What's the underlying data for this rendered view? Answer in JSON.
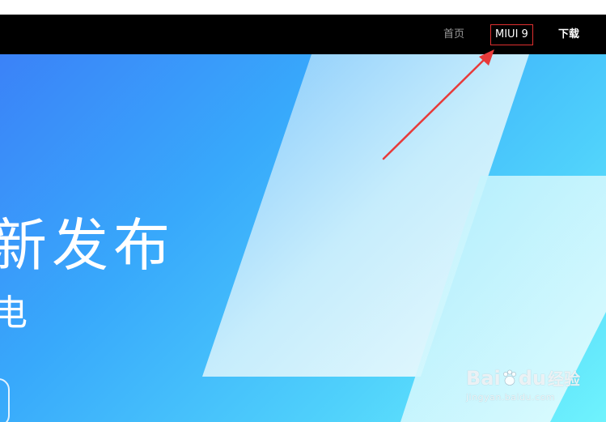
{
  "nav": {
    "items": [
      {
        "label": "首页"
      },
      {
        "label": "MIUI 9"
      },
      {
        "label": "下载"
      }
    ]
  },
  "hero": {
    "title": "新发布",
    "subtitle": "电"
  },
  "watermark": {
    "logo": "Bai",
    "logo_suffix": "du",
    "logo_cn": "经验",
    "url": "jingyan.baidu.com"
  },
  "colors": {
    "navbar_bg": "#000000",
    "nav_inactive": "#9a9a9a",
    "nav_active": "#ffffff",
    "highlight": "#e03030",
    "annotation_arrow": "#e83a3a",
    "hero_gradient_start": "#3b82f8",
    "hero_gradient_end": "#6ff3fd"
  },
  "icons": {
    "annotation": "red-arrow-icon",
    "watermark_paw": "baidu-paw-icon"
  }
}
